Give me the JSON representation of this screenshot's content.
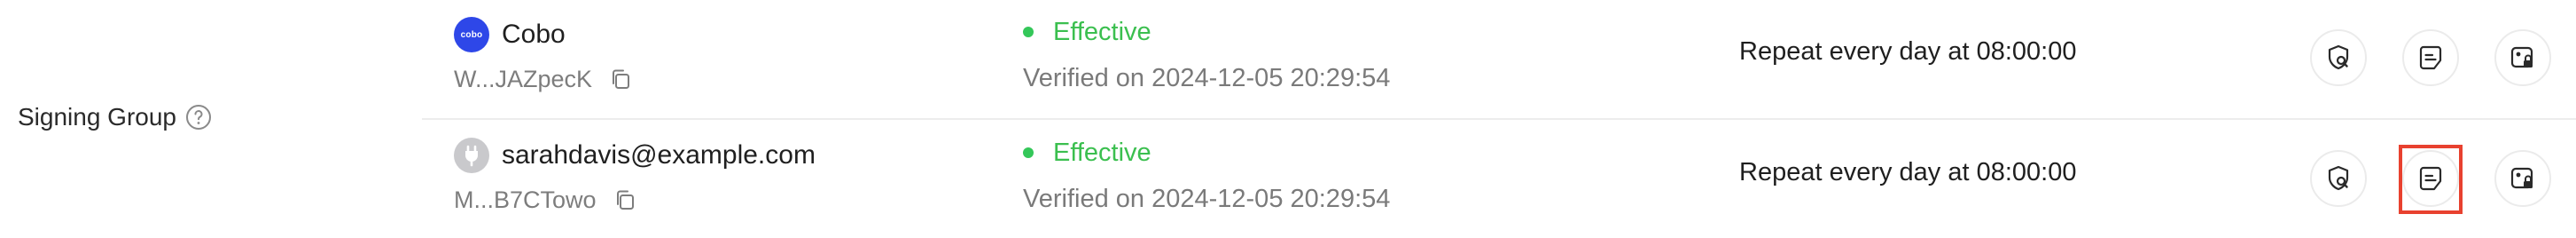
{
  "field_label": "Signing Group",
  "rows": [
    {
      "avatar_text": "cobo",
      "account_name": "Cobo",
      "address": "W...JAZpecK",
      "status": "Effective",
      "verified": "Verified on 2024-12-05 20:29:54",
      "schedule": "Repeat every day at 08:00:00"
    },
    {
      "avatar_text": "",
      "account_name": "sarahdavis@example.com",
      "address": "M...B7CTowo",
      "status": "Effective",
      "verified": "Verified on 2024-12-05 20:29:54",
      "schedule": "Repeat every day at 08:00:00"
    }
  ],
  "colors": {
    "status_green": "#3bbf4f",
    "brand_blue": "#2e47e8",
    "highlight_red": "#e8412f"
  },
  "icons": [
    "help-icon",
    "copy-icon",
    "shield-search-icon",
    "document-icon",
    "lock-card-icon",
    "plug-icon"
  ]
}
